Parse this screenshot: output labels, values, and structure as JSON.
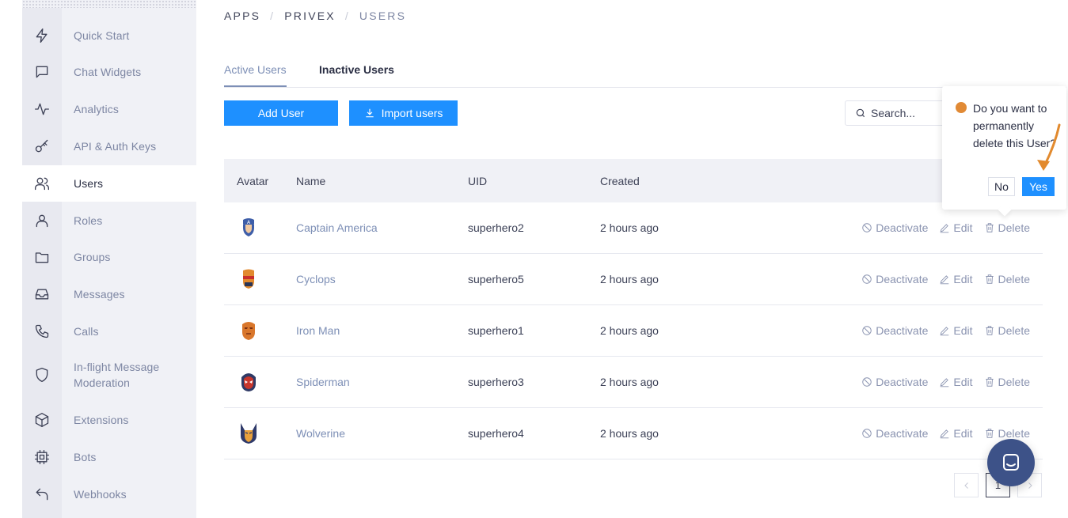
{
  "sidebar": {
    "items": [
      {
        "label": "Quick Start",
        "icon": "lightning-icon"
      },
      {
        "label": "Chat Widgets",
        "icon": "chat-bubble-icon"
      },
      {
        "label": "Analytics",
        "icon": "activity-icon"
      },
      {
        "label": "API & Auth Keys",
        "icon": "key-icon"
      },
      {
        "label": "Users",
        "icon": "users-icon",
        "active": true
      },
      {
        "label": "Roles",
        "icon": "user-icon"
      },
      {
        "label": "Groups",
        "icon": "folder-icon"
      },
      {
        "label": "Messages",
        "icon": "inbox-icon"
      },
      {
        "label": "Calls",
        "icon": "phone-icon"
      },
      {
        "label": "In-flight Message Moderation",
        "icon": "shield-icon"
      },
      {
        "label": "Extensions",
        "icon": "cube-icon"
      },
      {
        "label": "Bots",
        "icon": "chip-icon"
      },
      {
        "label": "Webhooks",
        "icon": "return-arrow-icon"
      }
    ]
  },
  "breadcrumb": {
    "items": [
      "APPS",
      "PRIVEX",
      "USERS"
    ],
    "separator": "/"
  },
  "tabs": {
    "active": "Active Users",
    "inactive": "Inactive Users"
  },
  "toolbar": {
    "add_label": "Add User",
    "import_label": "Import users",
    "search_placeholder": "Search..."
  },
  "table": {
    "headers": {
      "avatar": "Avatar",
      "name": "Name",
      "uid": "UID",
      "created": "Created"
    },
    "rows": [
      {
        "name": "Captain America",
        "uid": "superhero2",
        "created": "2 hours ago",
        "avatar_icon": "captain-america-avatar-icon"
      },
      {
        "name": "Cyclops",
        "uid": "superhero5",
        "created": "2 hours ago",
        "avatar_icon": "cyclops-avatar-icon"
      },
      {
        "name": "Iron Man",
        "uid": "superhero1",
        "created": "2 hours ago",
        "avatar_icon": "iron-man-avatar-icon"
      },
      {
        "name": "Spiderman",
        "uid": "superhero3",
        "created": "2 hours ago",
        "avatar_icon": "spiderman-avatar-icon"
      },
      {
        "name": "Wolverine",
        "uid": "superhero4",
        "created": "2 hours ago",
        "avatar_icon": "wolverine-avatar-icon"
      }
    ],
    "actions": {
      "deactivate": "Deactivate",
      "edit": "Edit",
      "delete": "Delete"
    }
  },
  "popconfirm": {
    "message": "Do you want to permanently delete this User?",
    "no_label": "No",
    "yes_label": "Yes"
  },
  "pagination": {
    "current_page": "1",
    "prev_icon": "chevron-left-icon",
    "next_icon": "chevron-right-icon"
  },
  "colors": {
    "primary": "#1e90ff",
    "link": "#7d8fb6",
    "sidebar_bg": "#f0f1f6",
    "warning_dot": "#e18a35",
    "chat_launcher": "#3d5288"
  }
}
